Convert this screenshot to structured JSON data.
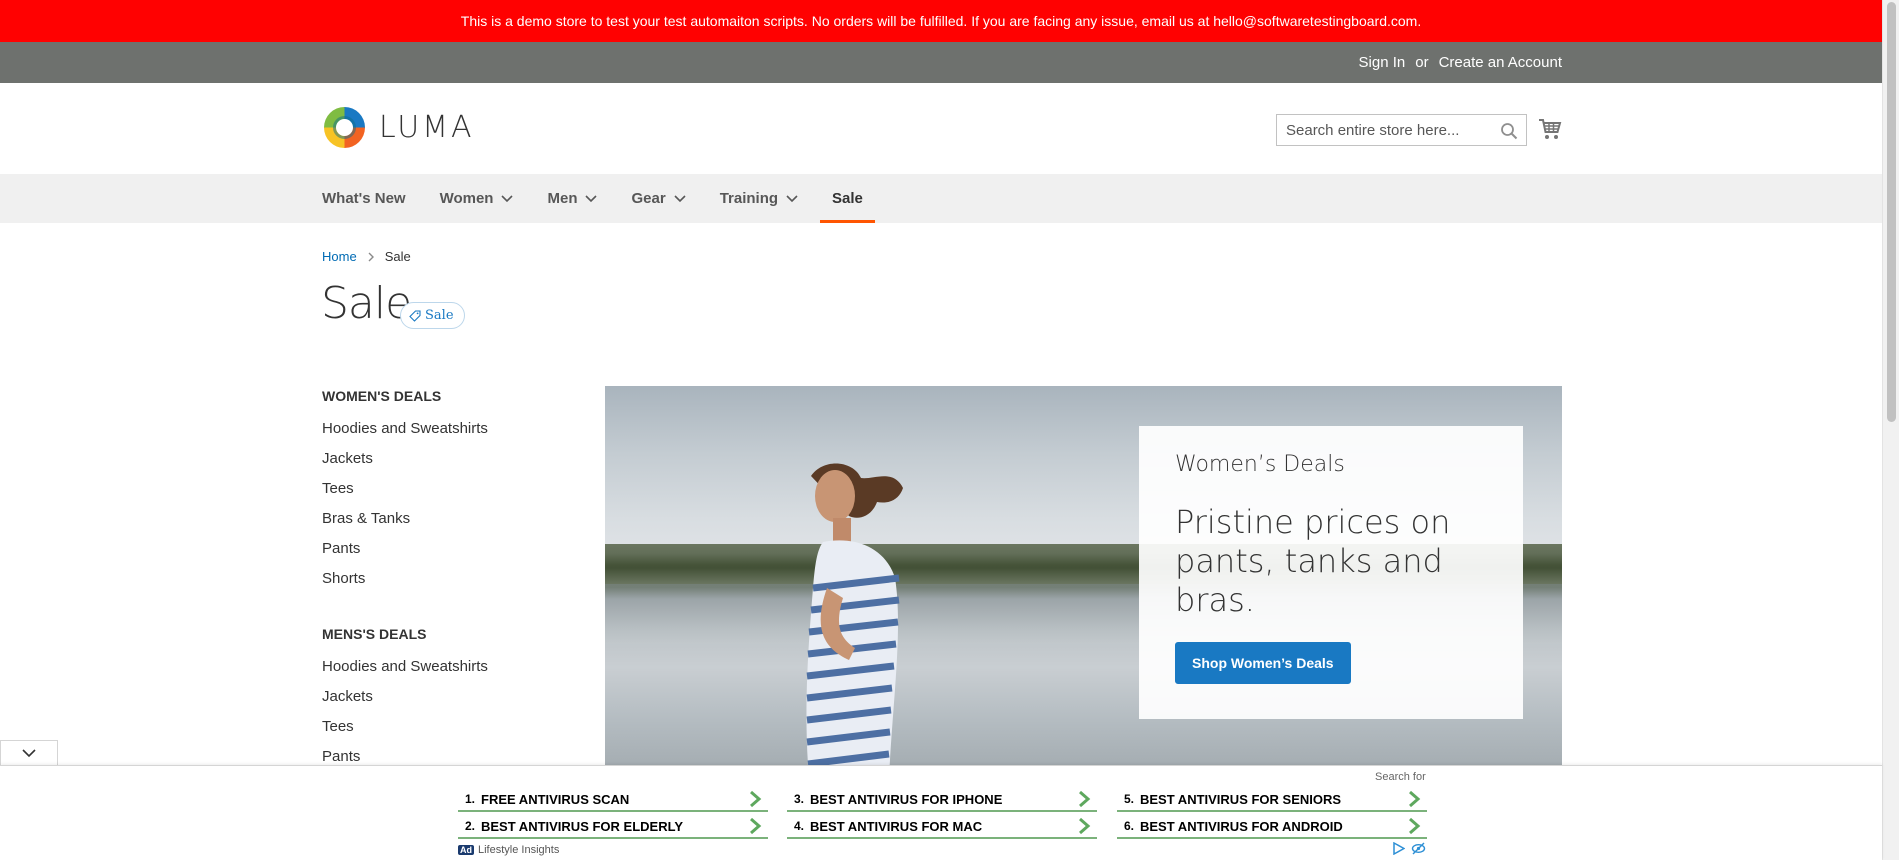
{
  "banner": {
    "text": "This is a demo store to test your test automaiton scripts. No orders will be fulfilled. If you are facing any issue, email us at hello@softwaretestingboard.com."
  },
  "header_links": {
    "sign_in": "Sign In",
    "or": "or",
    "create_account": "Create an Account"
  },
  "logo": {
    "text": "LUMA"
  },
  "search": {
    "placeholder": "Search entire store here..."
  },
  "nav": {
    "items": [
      {
        "label": "What's New",
        "has_dropdown": false
      },
      {
        "label": "Women",
        "has_dropdown": true
      },
      {
        "label": "Men",
        "has_dropdown": true
      },
      {
        "label": "Gear",
        "has_dropdown": true
      },
      {
        "label": "Training",
        "has_dropdown": true
      },
      {
        "label": "Sale",
        "has_dropdown": false,
        "active": true
      }
    ]
  },
  "breadcrumbs": {
    "home": "Home",
    "current": "Sale"
  },
  "page": {
    "title": "Sale",
    "tag_label": "Sale"
  },
  "sidebar": {
    "womens_title": "WOMEN'S DEALS",
    "womens_items": [
      "Hoodies and Sweatshirts",
      "Jackets",
      "Tees",
      "Bras & Tanks",
      "Pants",
      "Shorts"
    ],
    "mens_title": "MENS'S DEALS",
    "mens_items": [
      "Hoodies and Sweatshirts",
      "Jackets",
      "Tees",
      "Pants"
    ]
  },
  "hero": {
    "kicker": "Women’s Deals",
    "headline": "Pristine prices on pants, tanks and bras.",
    "cta": "Shop Women’s Deals"
  },
  "ad": {
    "search_for": "Search for",
    "items": [
      {
        "num": "1.",
        "text": "FREE ANTIVIRUS SCAN"
      },
      {
        "num": "2.",
        "text": "BEST ANTIVIRUS FOR ELDERLY"
      },
      {
        "num": "3.",
        "text": "BEST ANTIVIRUS FOR IPHONE"
      },
      {
        "num": "4.",
        "text": "BEST ANTIVIRUS FOR MAC"
      },
      {
        "num": "5.",
        "text": "BEST ANTIVIRUS FOR SENIORS"
      },
      {
        "num": "6.",
        "text": "BEST ANTIVIRUS FOR ANDROID"
      }
    ],
    "badge": "Ad",
    "sponsor": "Lifestyle Insights"
  },
  "colors": {
    "banner_bg": "#ff0101",
    "header_bg": "#6e716e",
    "nav_bg": "#f0f0f0",
    "nav_active_underline": "#ff5501",
    "link": "#006bb4",
    "button_primary": "#1979c3",
    "ad_underline": "#7bb27b"
  }
}
